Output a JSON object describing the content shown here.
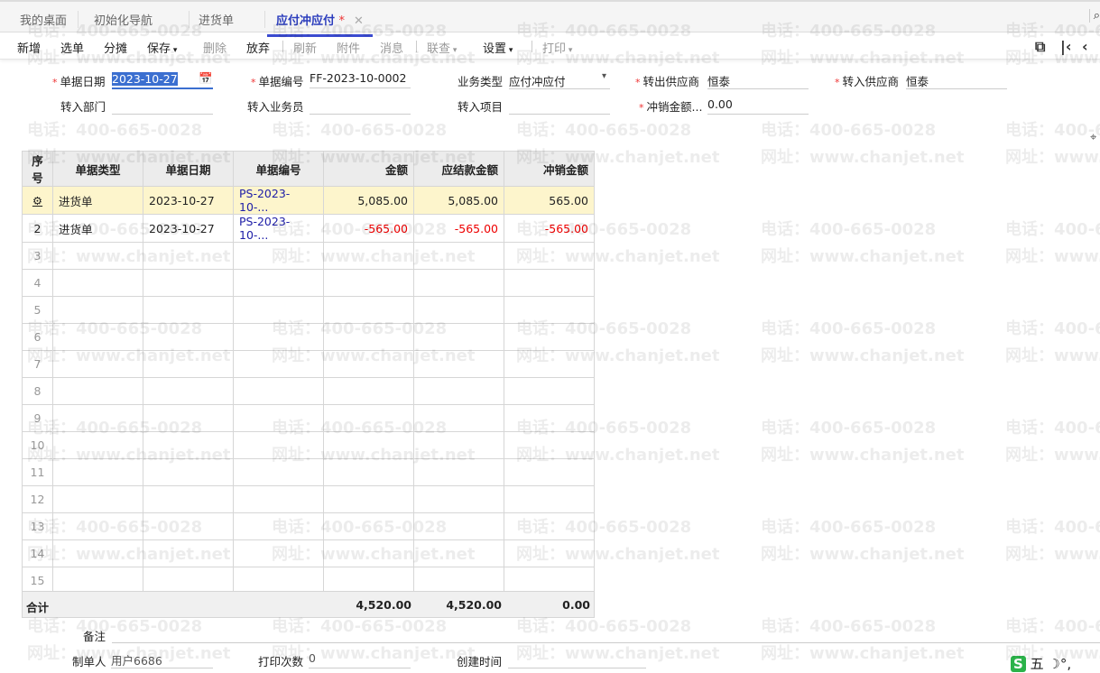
{
  "tabs": [
    {
      "label": "我的桌面"
    },
    {
      "label": "初始化导航"
    },
    {
      "label": "进货单"
    },
    {
      "label": "应付冲应付",
      "modified": "*",
      "close": "✕"
    }
  ],
  "toolbar": {
    "items": [
      "新增",
      "选单",
      "分摊",
      "保存",
      "删除",
      "放弃",
      "刷新",
      "附件",
      "消息",
      "联查",
      "设置",
      "打印"
    ]
  },
  "form": {
    "date_label": "单据日期",
    "date_value": "2023-10-27",
    "code_label": "单据编号",
    "code_value": "FF-2023-10-0002",
    "biz_label": "业务类型",
    "biz_value": "应付冲应付",
    "out_supplier_label": "转出供应商",
    "out_supplier_value": "恒泰",
    "in_supplier_label": "转入供应商",
    "in_supplier_value": "恒泰",
    "dept_label": "转入部门",
    "staff_label": "转入业务员",
    "project_label": "转入项目",
    "amount_label": "冲销金额...",
    "amount_value": "0.00"
  },
  "table": {
    "headers": [
      "序号",
      "单据类型",
      "单据日期",
      "单据编号",
      "金额",
      "应结款金额",
      "冲销金额"
    ],
    "rows": [
      [
        "",
        "进货单",
        "2023-10-27",
        "PS-2023-10-...",
        "5,085.00",
        "5,085.00",
        "565.00"
      ],
      [
        "2",
        "进货单",
        "2023-10-27",
        "PS-2023-10-...",
        "-565.00",
        "-565.00",
        "-565.00"
      ]
    ],
    "empty_rows": [
      "3",
      "4",
      "5",
      "6",
      "7",
      "8",
      "9",
      "10",
      "11",
      "12",
      "13",
      "14",
      "15"
    ]
  },
  "total": {
    "label": "合计",
    "amount": "4,520.00",
    "settle": "4,520.00",
    "writeoff": "0.00"
  },
  "footer": {
    "remark_label": "备注",
    "maker_label": "制单人",
    "maker_value": "用户6686",
    "print_label": "打印次数",
    "print_value": "0",
    "created_label": "创建时间"
  },
  "ime": {
    "mode": "五"
  },
  "watermark": {
    "phone": "电话：400-665-0028",
    "site": "网址：www.chanjet.net"
  },
  "colors": {
    "accent": "#3b4bd0",
    "negative": "#e00000",
    "selected_row": "#fdf5cc"
  }
}
